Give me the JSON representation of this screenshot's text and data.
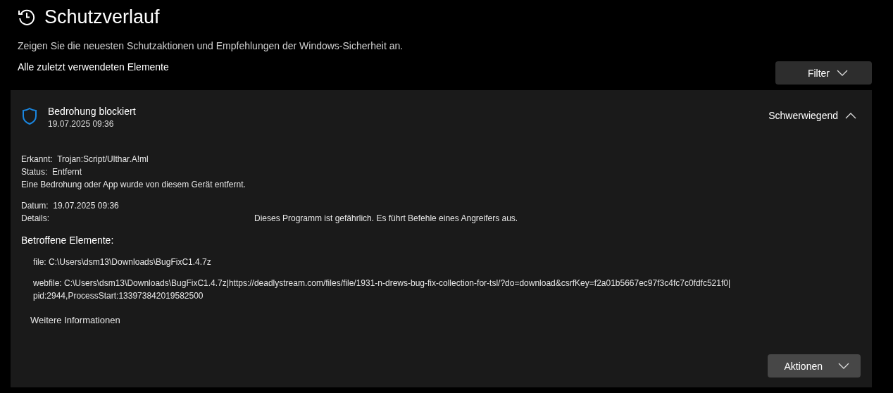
{
  "page": {
    "title": "Schutzverlauf",
    "description": "Zeigen Sie die neuesten Schutzaktionen und Empfehlungen der Windows-Sicherheit an.",
    "section_label": "Alle zuletzt verwendeten Elemente",
    "filter_button": "Filter"
  },
  "event": {
    "title": "Bedrohung blockiert",
    "timestamp": "19.07.2025 09:36",
    "severity": "Schwerwiegend",
    "expanded": true,
    "fields": [
      {
        "label": "Erkannt:",
        "value": "Trojan:Script/Ulthar.A!ml"
      },
      {
        "label": "Status:",
        "value": "Entfernt"
      }
    ],
    "status_message": "Eine Bedrohung oder App wurde von diesem Gerät entfernt.",
    "date": {
      "label": "Datum:",
      "value": "19.07.2025 09:36"
    },
    "details": {
      "label": "Details:",
      "value": "Dieses Programm ist gefährlich. Es führt Befehle eines Angreifers aus."
    },
    "affected_heading": "Betroffene Elemente:",
    "affected_items": [
      {
        "lines": [
          "file: C:\\Users\\dsm13\\Downloads\\BugFixC1.4.7z"
        ]
      },
      {
        "lines": [
          "webfile: C:\\Users\\dsm13\\Downloads\\BugFixC1.4.7z|https://deadlystream.com/files/file/1931-n-drews-bug-fix-collection-for-tsl/?do=download&csrfKey=f2a01b5667ec97f3c4fc7c0fdfc521f0|",
          "pid:2944,ProcessStart:133973842019582500"
        ]
      }
    ],
    "more_info_link": "Weitere Informationen",
    "actions_button": "Aktionen"
  }
}
